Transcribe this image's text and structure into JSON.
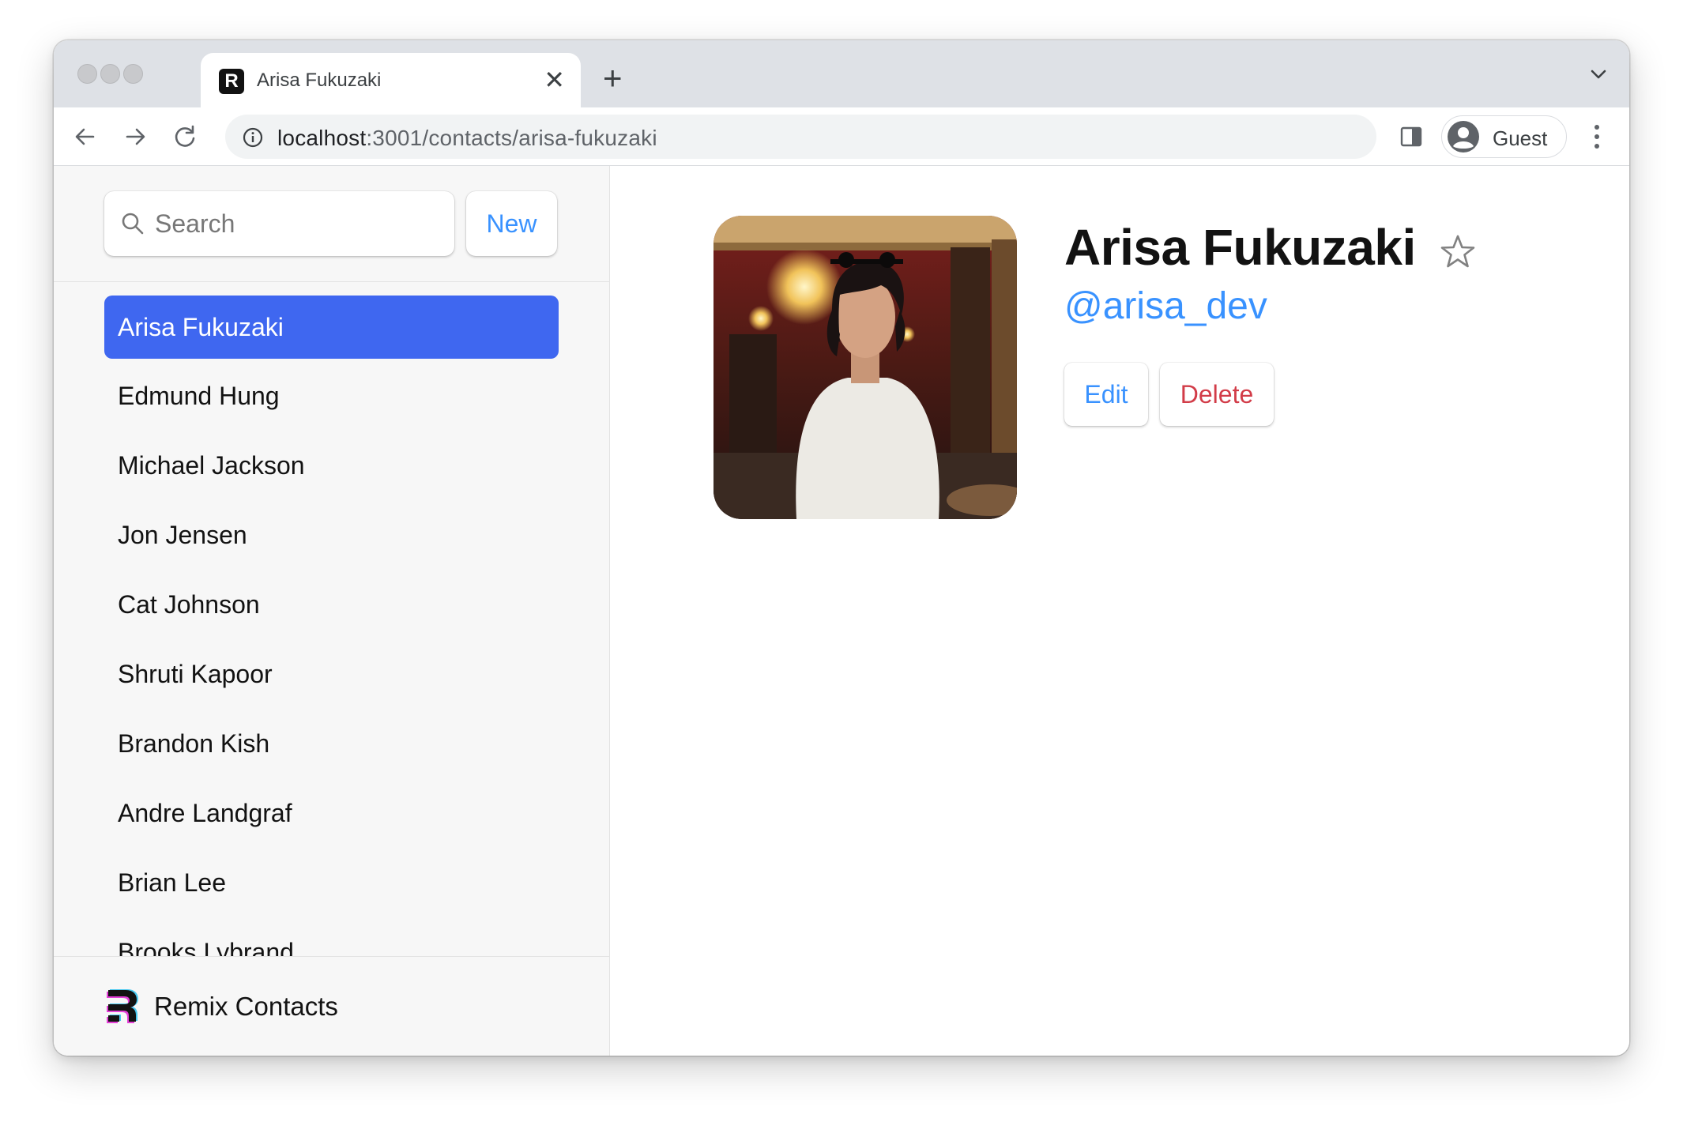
{
  "browser": {
    "tab_title": "Arisa Fukuzaki",
    "favicon_letter": "R",
    "url_host": "localhost",
    "url_path": ":3001/contacts/arisa-fukuzaki",
    "profile_label": "Guest"
  },
  "sidebar": {
    "search_placeholder": "Search",
    "new_button_label": "New",
    "contacts": [
      {
        "name": "Arisa Fukuzaki",
        "active": true
      },
      {
        "name": "Edmund Hung"
      },
      {
        "name": "Michael Jackson"
      },
      {
        "name": "Jon Jensen"
      },
      {
        "name": "Cat Johnson"
      },
      {
        "name": "Shruti Kapoor"
      },
      {
        "name": "Brandon Kish"
      },
      {
        "name": "Andre Landgraf"
      },
      {
        "name": "Brian Lee"
      },
      {
        "name": "Brooks Lybrand"
      }
    ],
    "footer_brand": "Remix Contacts"
  },
  "contact": {
    "name": "Arisa Fukuzaki",
    "handle": "@arisa_dev",
    "favorite": false,
    "edit_label": "Edit",
    "delete_label": "Delete"
  },
  "colors": {
    "accent": "#3992ff",
    "active_item": "#3f67f0",
    "danger": "#d23c48"
  }
}
